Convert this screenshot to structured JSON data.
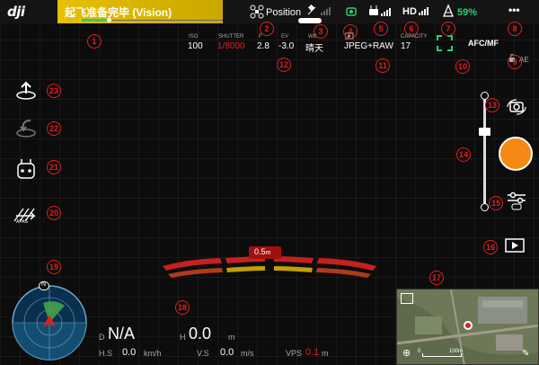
{
  "app": {
    "logo": "dji"
  },
  "status": {
    "message": "起飞准备完毕 (Vision)",
    "progress": 0.22
  },
  "topbar": {
    "flight_mode": "Position",
    "video_label": "HD",
    "battery": "59%",
    "more": "•••",
    "colors": {
      "status_bg": "#e7c000",
      "battery": "#2ecc71",
      "accent": "#f48a14",
      "warning": "#e02020"
    }
  },
  "camera": {
    "iso_label": "ISO",
    "iso": "100",
    "shutter_label": "SHUTTER",
    "shutter": "1/8000",
    "f_label": "F",
    "f": "2.8",
    "ev_label": "EV",
    "ev": "-3.0",
    "wb_label": "WB",
    "wb": "晴天",
    "format": "JPEG+RAW",
    "capacity_label": "CAPACITY",
    "capacity": "17",
    "focus_mode": "AFC/MF",
    "ae_label": "AE"
  },
  "markers": [
    "1",
    "2",
    "3",
    "4",
    "5",
    "6",
    "7",
    "8",
    "9",
    "10",
    "11",
    "12",
    "13",
    "14",
    "15",
    "16",
    "17",
    "18",
    "19",
    "20",
    "21",
    "22",
    "23"
  ],
  "sidebar": {
    "icons": [
      "takeoff-icon",
      "return-home-icon",
      "remote-controller-icon",
      "apas-icon"
    ],
    "apas_label": "APAS"
  },
  "obstacle": {
    "distance": "0.5",
    "unit": "m"
  },
  "telemetry": {
    "d_label": "D",
    "d_value": "N/A",
    "h_label": "H",
    "h_value": "0.0",
    "h_unit": "m",
    "hs_label": "H.S",
    "hs_value": "0.0",
    "hs_unit": "km/h",
    "vs_label": "V.S",
    "vs_value": "0.0",
    "vs_unit": "m/s",
    "vps_label": "VPS",
    "vps_value": "0.1",
    "vps_unit": "m"
  },
  "compass": {
    "north": "N"
  },
  "map": {
    "scale": "100m",
    "scale_start": "0"
  }
}
